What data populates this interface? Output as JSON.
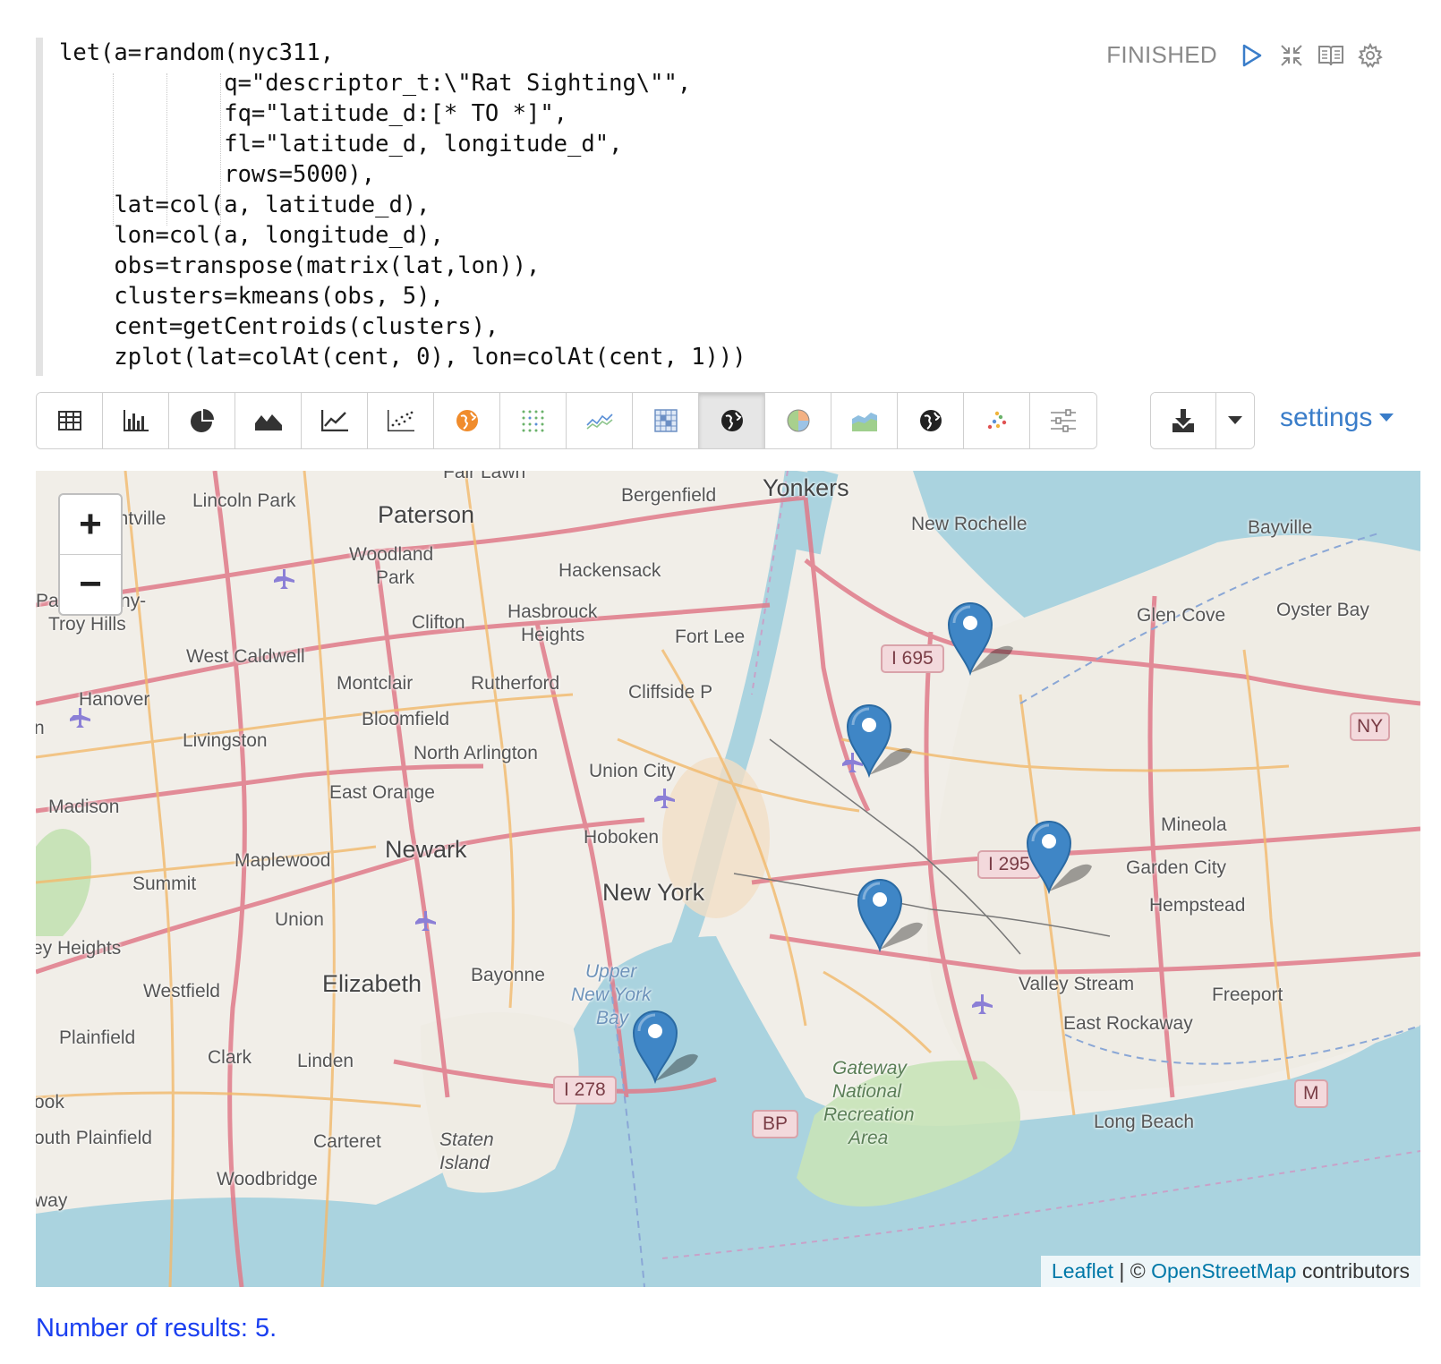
{
  "editor": {
    "lines": [
      "let(a=random(nyc311,",
      "            q=\"descriptor_t:\\\"Rat Sighting\\\"\",",
      "            fq=\"latitude_d:[* TO *]\",",
      "            fl=\"latitude_d, longitude_d\",",
      "            rows=5000),",
      "    lat=col(a, latitude_d),",
      "    lon=col(a, longitude_d),",
      "    obs=transpose(matrix(lat,lon)),",
      "    clusters=kmeans(obs, 5),",
      "    cent=getCentroids(clusters),",
      "    zplot(lat=colAt(cent, 0), lon=colAt(cent, 1)))"
    ]
  },
  "status": {
    "state": "FINISHED",
    "icons": [
      "run-icon",
      "collapse-icon",
      "book-icon",
      "gear-icon"
    ]
  },
  "toolbar": {
    "buttons": [
      {
        "name": "table-icon"
      },
      {
        "name": "bar-chart-icon"
      },
      {
        "name": "pie-chart-icon"
      },
      {
        "name": "area-chart-icon"
      },
      {
        "name": "line-chart-icon"
      },
      {
        "name": "scatter-chart-icon"
      },
      {
        "name": "orange-globe-icon"
      },
      {
        "name": "dots-grid-icon"
      },
      {
        "name": "sparkline-icon"
      },
      {
        "name": "heatmap-icon"
      },
      {
        "name": "map-globe-icon",
        "active": true
      },
      {
        "name": "pie-color-icon"
      },
      {
        "name": "area-color-icon"
      },
      {
        "name": "globe-icon"
      },
      {
        "name": "scatter-color-icon"
      },
      {
        "name": "sliders-icon"
      }
    ],
    "download_icon": "download-icon",
    "caret_icon": "caret-down-icon",
    "settings_label": "settings"
  },
  "map": {
    "zoom_in": "+",
    "zoom_out": "−",
    "attribution": {
      "leaflet": "Leaflet",
      "sep": " | © ",
      "osm": "OpenStreetMap",
      "suffix": " contributors"
    },
    "places": [
      {
        "t": "Yonkers",
        "big": true
      },
      {
        "t": "Paterson",
        "big": true
      },
      {
        "t": "Bergenfield"
      },
      {
        "t": "Fair Lawn"
      },
      {
        "t": "Lincoln Park"
      },
      {
        "t": "ontville"
      },
      {
        "t": "Woodland"
      },
      {
        "t": "Park"
      },
      {
        "t": "New Rochelle"
      },
      {
        "t": "Bayville"
      },
      {
        "t": "Hackensack"
      },
      {
        "t": "Hasbrouck"
      },
      {
        "t": "Heights"
      },
      {
        "t": "Clifton"
      },
      {
        "t": "Troy Hills"
      },
      {
        "t": "Pa"
      },
      {
        "t": "ny-"
      },
      {
        "t": "West Caldwell"
      },
      {
        "t": "Fort Lee"
      },
      {
        "t": "Glen Cove"
      },
      {
        "t": "Oyster Bay"
      },
      {
        "t": "Montclair"
      },
      {
        "t": "Rutherford"
      },
      {
        "t": "Cliffside P"
      },
      {
        "t": "Hanover"
      },
      {
        "t": "Bloomfield"
      },
      {
        "t": "Livingston"
      },
      {
        "t": "North Arlington"
      },
      {
        "t": "Union City"
      },
      {
        "t": "East Orange"
      },
      {
        "t": "Madison"
      },
      {
        "t": "Hoboken"
      },
      {
        "t": "Newark",
        "big": true
      },
      {
        "t": "Maplewood"
      },
      {
        "t": "Summit"
      },
      {
        "t": "New York",
        "big": true
      },
      {
        "t": "Mineola"
      },
      {
        "t": "Garden City"
      },
      {
        "t": "Hempstead"
      },
      {
        "t": "Union"
      },
      {
        "t": "ey Heights"
      },
      {
        "t": "Westfield"
      },
      {
        "t": "Elizabeth",
        "big": true
      },
      {
        "t": "Bayonne"
      },
      {
        "t": "Upper",
        "water": true
      },
      {
        "t": "New York",
        "water": true
      },
      {
        "t": "Bay",
        "water": true
      },
      {
        "t": "Valley Stream"
      },
      {
        "t": "Freeport"
      },
      {
        "t": "East Rockaway"
      },
      {
        "t": "Plainfield"
      },
      {
        "t": "Clark"
      },
      {
        "t": "Linden"
      },
      {
        "t": "Gateway",
        "park": true
      },
      {
        "t": "National",
        "park": true
      },
      {
        "t": "Recreation",
        "park": true
      },
      {
        "t": "Area",
        "park": true
      },
      {
        "t": "ook"
      },
      {
        "t": "outh Plainfield"
      },
      {
        "t": "Carteret"
      },
      {
        "t": "Staten"
      },
      {
        "t": "Island"
      },
      {
        "t": "Long Beach"
      },
      {
        "t": "Woodbridge"
      },
      {
        "t": "way"
      },
      {
        "t": "n"
      }
    ],
    "shields": [
      "I 695",
      "I 295",
      "I 278",
      "BP",
      "NY",
      "M"
    ],
    "markers": [
      {
        "lat": 40.86,
        "lon": -73.86
      },
      {
        "lat": 40.79,
        "lon": -73.95
      },
      {
        "lat": 40.71,
        "lon": -73.79
      },
      {
        "lat": 40.67,
        "lon": -73.94
      },
      {
        "lat": 40.58,
        "lon": -74.14
      }
    ]
  },
  "results": "Number of results: 5."
}
